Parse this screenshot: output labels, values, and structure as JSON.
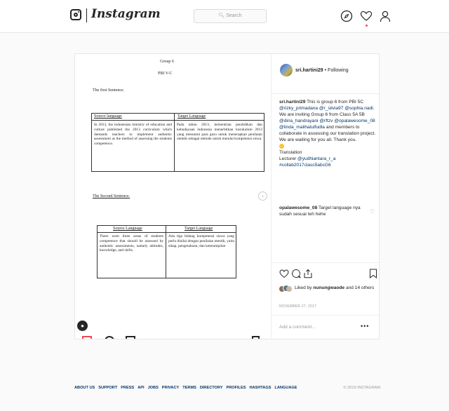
{
  "nav": {
    "brand": "Instagram",
    "search_placeholder": "Search",
    "icons": [
      "instagram-camera-icon",
      "compass-icon",
      "heart-icon",
      "profile-icon"
    ]
  },
  "post": {
    "document": {
      "group_title": "Group 6",
      "class_title": "PBI V-C",
      "first_heading": "The first Sentence.",
      "table1": {
        "source_header": "Source language",
        "target_header": "Target Language",
        "source_text": "In 2013, the indonesian ministry of education and culture published the 2013 curriculum which demands teachers to implement authentic assessment as the method of assessing the students competence.",
        "target_text": "Pada tahun 2013, kementrian pendidikan dan kebudayaan indonesia menerbitkan kurukulum 2013 yang menuntut para guru untuk menerapkan penilaian otentik sebagai metode untuk menilai kompetensi siswa."
      },
      "second_heading": "The Second Sentence.",
      "table2": {
        "source_header": "Source Language",
        "target_header": "Target Language",
        "source_text": "There were three areas of students competence that should be assessed by authentic assessments, namely attitudes, knowledge, and skills.",
        "target_text": "Ada tiga bidang kompetensi siswa yang perlu dinilai dengan penilaian otentik, yaitu sikap, pengetahuan, dan keterampilan"
      }
    },
    "author": {
      "username": "sri.hartini29",
      "separator": "•",
      "follow_state": "Following"
    },
    "caption": {
      "username": "sri.hartini29",
      "text_1": "This is group 6 from PBI 5C",
      "mention_1": "@rizky_primadana",
      "mention_2": "@r_silvia97",
      "mention_3": "@sophia.nadi",
      "text_2": ". We are inviting Group 6 from Class 5A 5B",
      "mention_4": "@dina_handrayani",
      "mention_5": "@rftzv",
      "mention_6": "@opalawesome_08",
      "mention_7": "@linda_malihatulfudla",
      "text_3": "and members to collaborate in assessing our translation project. We are waiting for you all. Thank you.",
      "translation_label": "Translation",
      "lecturer_label": "Lecturer",
      "lecturer_mention": "@yudhiantara_r_a",
      "hashtag": "#collab2017class5abcG6"
    },
    "comment": {
      "username": "opalawesome_08",
      "text": "Target language nya sudah sesuai teh hehe"
    },
    "likes": {
      "prefix": "Liked by",
      "user": "nunungwaode",
      "suffix": "and 14 others"
    },
    "date": "NOVEMBER 27, 2017",
    "add_comment_placeholder": "Add a comment...",
    "more_label": "•••"
  },
  "footer": {
    "links": [
      "ABOUT US",
      "SUPPORT",
      "PRESS",
      "API",
      "JOBS",
      "PRIVACY",
      "TERMS",
      "DIRECTORY",
      "PROFILES",
      "HASHTAGS",
      "LANGUAGE"
    ],
    "copyright": "© 2019 INSTAGRAM"
  },
  "colors": {
    "link": "#003569",
    "notification_dot": "#ed4956",
    "border": "#e6e6e6",
    "background": "#fafafa"
  }
}
